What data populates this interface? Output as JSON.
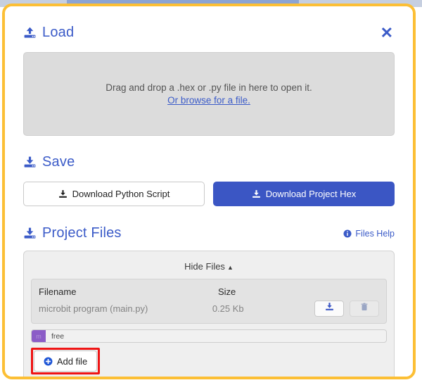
{
  "dialog": {
    "close_label": "✕"
  },
  "load": {
    "title": "Load",
    "icon": "upload-icon",
    "dropzone_text": "Drag and drop a .hex or .py file in here to open it.",
    "browse_link": "Or browse for a file."
  },
  "save": {
    "title": "Save",
    "icon": "download-icon",
    "buttons": [
      {
        "label": "Download Python Script",
        "icon": "download-icon",
        "style": "secondary"
      },
      {
        "label": "Download Project Hex",
        "icon": "download-icon",
        "style": "primary"
      }
    ]
  },
  "project_files": {
    "title": "Project Files",
    "icon": "download-icon",
    "help_label": "Files Help",
    "help_icon": "info-icon",
    "toggle_label": "Hide Files",
    "toggle_caret": "▲",
    "columns": [
      "Filename",
      "Size"
    ],
    "rows": [
      {
        "filename": "microbit program (main.py)",
        "size": "0.25 Kb",
        "download_icon": "download-icon",
        "delete_icon": "trash-icon"
      }
    ],
    "storage": {
      "used_label": "m",
      "free_label": "free",
      "used_color": "#8b5cc7"
    },
    "add_file_label": "Add file",
    "add_file_icon": "plus-circle-icon"
  },
  "colors": {
    "accent_blue": "#3b5bc8",
    "primary_button": "#3b56c4",
    "focus_outline": "#fcbf35",
    "annotation_red": "#ef1414",
    "storage_purple": "#8b5cc7"
  }
}
